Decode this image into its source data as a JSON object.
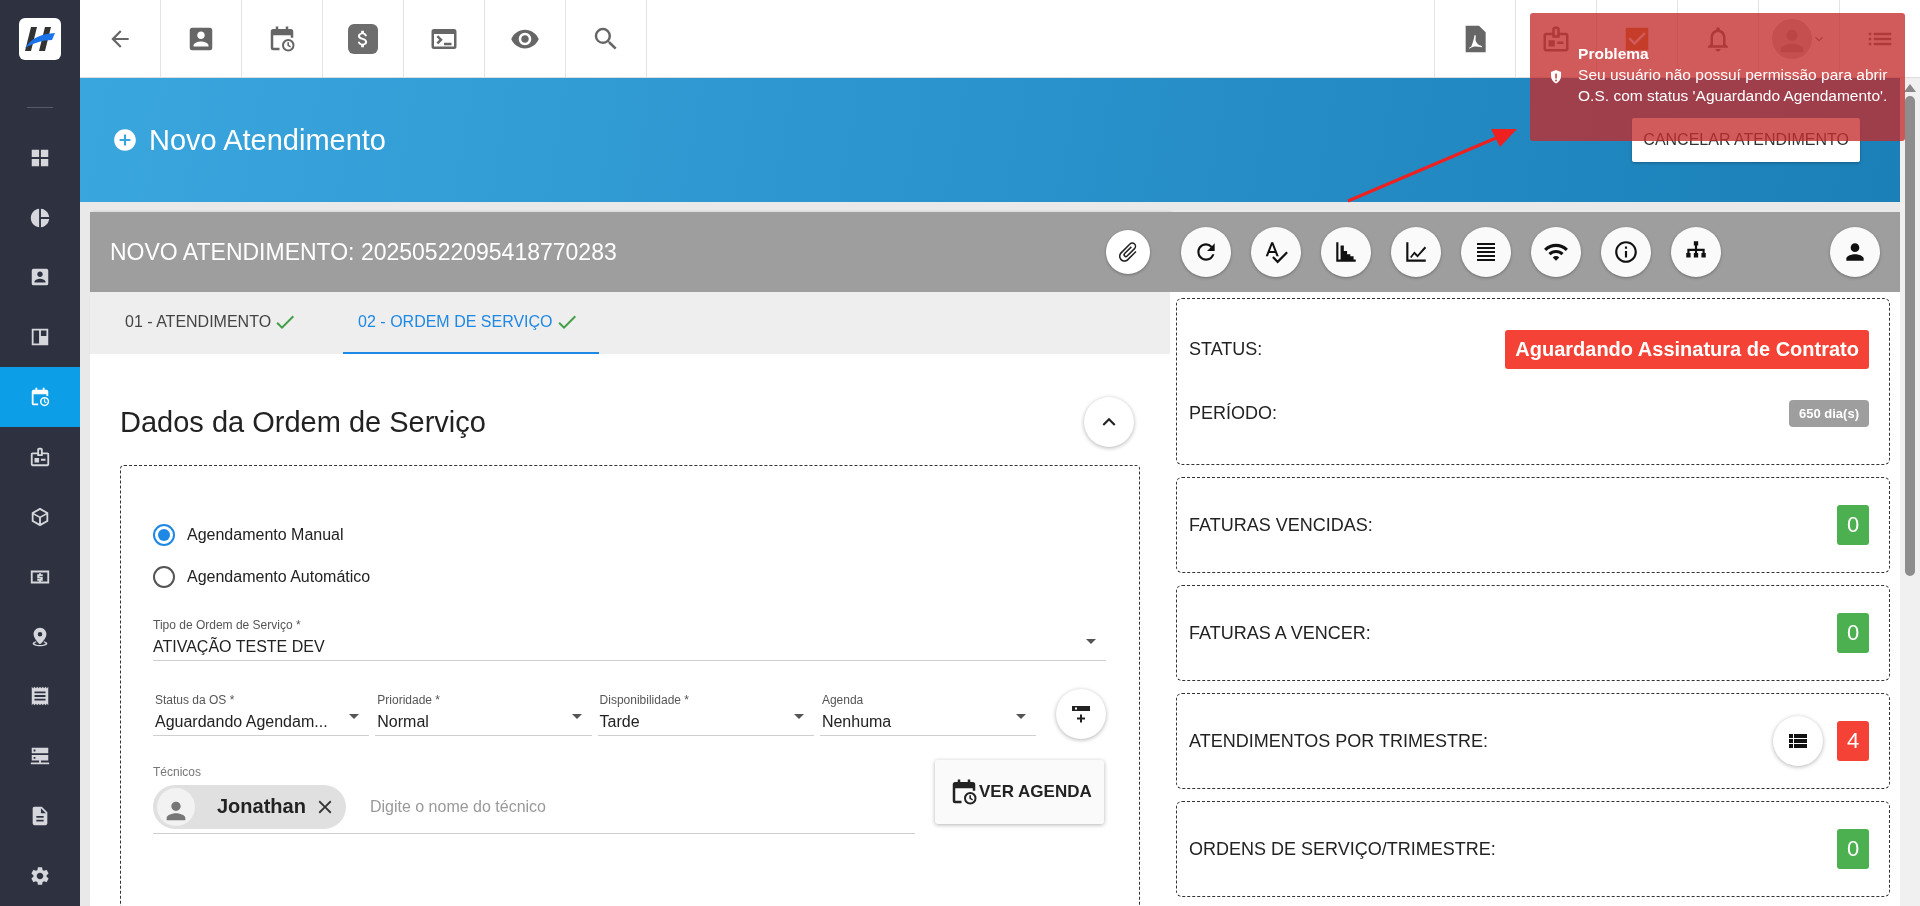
{
  "sidebar": {
    "items": [
      {
        "selected": false
      },
      {
        "selected": false
      },
      {
        "selected": false
      },
      {
        "selected": false
      },
      {
        "selected": true
      },
      {
        "selected": false
      },
      {
        "selected": false
      },
      {
        "selected": false
      },
      {
        "selected": false
      },
      {
        "selected": false
      },
      {
        "selected": false
      },
      {
        "selected": false
      },
      {
        "selected": false
      }
    ]
  },
  "banner": {
    "title": "Novo Atendimento",
    "cancel_button": "CANCELAR ATENDIMENTO"
  },
  "card": {
    "title": "NOVO ATENDIMENTO: 20250522095418770283",
    "tabs": [
      {
        "label": "01 - ATENDIMENTO",
        "selected": false,
        "done": true
      },
      {
        "label": "02 - ORDEM DE SERVIÇO",
        "selected": true,
        "done": true
      }
    ]
  },
  "form": {
    "title": "Dados da Ordem de Serviço",
    "scheduling": [
      {
        "label": "Agendamento Manual",
        "selected": true
      },
      {
        "label": "Agendamento Automático",
        "selected": false
      }
    ],
    "service_type": {
      "label": "Tipo de Ordem de Serviço *",
      "value": "ATIVAÇÃO TESTE DEV"
    },
    "selects": [
      {
        "label": "Status da OS *",
        "value": "Aguardando Agendam..."
      },
      {
        "label": "Prioridade *",
        "value": "Normal"
      },
      {
        "label": "Disponibilidade *",
        "value": "Tarde"
      },
      {
        "label": "Agenda",
        "value": "Nenhuma"
      }
    ],
    "technicians": {
      "label": "Técnicos",
      "chips": [
        {
          "name": "Jonathan"
        }
      ],
      "placeholder": "Digite o nome do técnico"
    },
    "agenda_button": "VER AGENDA"
  },
  "summary": {
    "status_label": "STATUS:",
    "status_value": "Aguardando Assinatura de Contrato",
    "period_label": "PERÍODO:",
    "period_value": "650 dia(s)",
    "counters": [
      {
        "label": "FATURAS VENCIDAS:",
        "value": "0",
        "color": "#4caf50",
        "has_list": false
      },
      {
        "label": "FATURAS A VENCER:",
        "value": "0",
        "color": "#4caf50",
        "has_list": false
      },
      {
        "label": "ATENDIMENTOS POR TRIMESTRE:",
        "value": "4",
        "color": "#f44336",
        "has_list": true
      },
      {
        "label": "ORDENS DE SERVIÇO/TRIMESTRE:",
        "value": "0",
        "color": "#4caf50",
        "has_list": false
      }
    ]
  },
  "toast": {
    "title": "Problema",
    "message": "Seu usuário não possuí permissão para abrir O.S. com status 'Aguardando Agendamento'."
  }
}
